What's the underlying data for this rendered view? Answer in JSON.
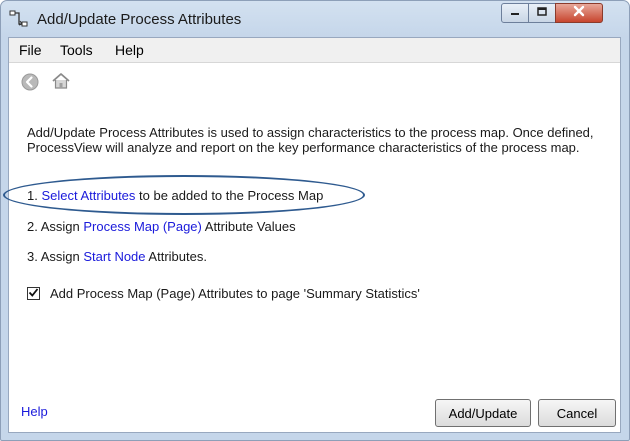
{
  "window": {
    "title": "Add/Update Process Attributes"
  },
  "menu": {
    "items": [
      "File",
      "Tools",
      "Help"
    ]
  },
  "intro": "Add/Update Process Attributes is used to assign characteristics to the process map.  Once defined, ProcessView will analyze and report on the key performance characteristics of the process map.",
  "steps": [
    {
      "prefix": "1. ",
      "link": "Select Attributes",
      "suffix": " to be added to the Process Map"
    },
    {
      "prefix": "2. Assign ",
      "link": "Process Map (Page)",
      "suffix": " Attribute Values"
    },
    {
      "prefix": "3. Assign ",
      "link": "Start Node",
      "suffix": " Attributes."
    }
  ],
  "checkbox": {
    "label": "Add Process Map (Page) Attributes to page 'Summary Statistics'",
    "checked": true
  },
  "footer": {
    "help_link": "Help",
    "add_update_label": "Add/Update",
    "cancel_label": "Cancel"
  },
  "icons": {
    "title": "process-map-icon",
    "back": "back-arrow-icon",
    "home": "home-icon"
  },
  "colors": {
    "link": "#1a1adb",
    "highlight_oval": "#2e5a8f"
  }
}
